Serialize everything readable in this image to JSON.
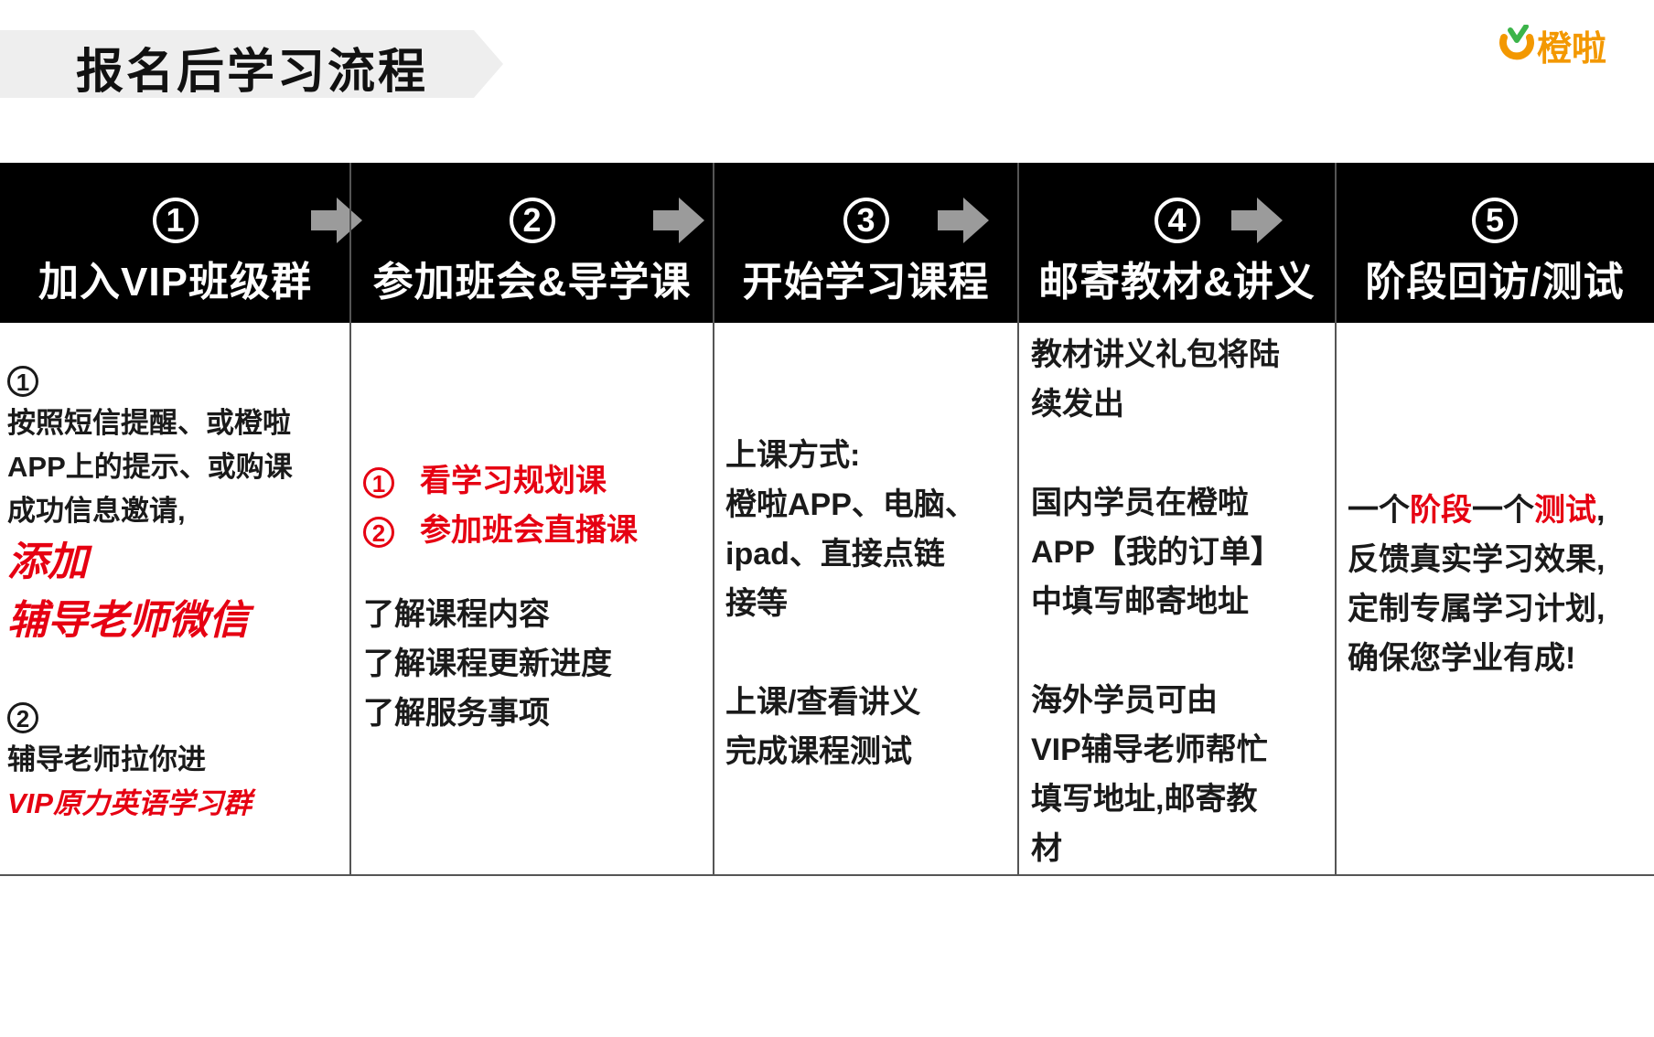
{
  "title": "报名后学习流程",
  "logo": {
    "text": "橙啦",
    "color": "#f39800"
  },
  "steps": [
    {
      "num": "1",
      "title": "加入VIP班级群"
    },
    {
      "num": "2",
      "title": "参加班会&导学课"
    },
    {
      "num": "3",
      "title": "开始学习课程"
    },
    {
      "num": "4",
      "title": "邮寄教材&讲义"
    },
    {
      "num": "5",
      "title": "阶段回访/测试"
    }
  ],
  "col1": {
    "n1": "1",
    "l1": "按照短信提醒、或橙啦",
    "l2": "APP上的提示、或购课",
    "l3": "成功信息邀请,",
    "r1": "添加",
    "r2": "辅导老师微信",
    "n2": "2",
    "l4": "辅导老师拉你进",
    "r3": "VIP原力英语学习群"
  },
  "col2": {
    "n1": "1",
    "i1": "看学习规划课",
    "n2": "2",
    "i2": "参加班会直播课",
    "l1": "了解课程内容",
    "l2": "了解课程更新进度",
    "l3": "了解服务事项"
  },
  "col3": {
    "l1": "上课方式:",
    "l2": "橙啦APP、电脑、",
    "l3": "ipad、直接点链",
    "l4": "接等",
    "l5": "上课/查看讲义",
    "l6": "完成课程测试"
  },
  "col4": {
    "l1": "教材讲义礼包将陆",
    "l2": "续发出",
    "l3": "国内学员在橙啦",
    "l4": "APP【我的订单】",
    "l5": "中填写邮寄地址",
    "l6": "海外学员可由",
    "l7": "VIP辅导老师帮忙",
    "l8": "填写地址,邮寄教",
    "l9": "材"
  },
  "col5": {
    "a1": "一个",
    "a2": "阶段",
    "a3": "一个",
    "a4": "测试",
    "a5": ",",
    "l2": "反馈真实学习效果,",
    "l3": "定制专属学习计划,",
    "l4": "确保您学业有成!"
  },
  "colors": {
    "accent_red": "#e60012",
    "header_bg": "#000000",
    "arrow": "#9b9b9b"
  }
}
